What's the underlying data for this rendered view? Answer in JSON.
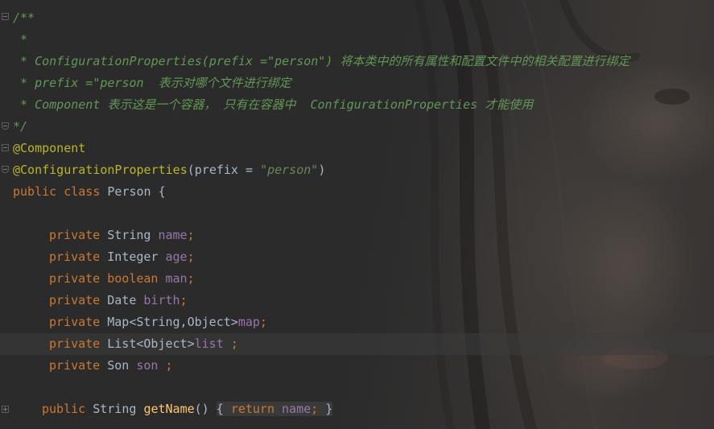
{
  "comment": {
    "open": "/**",
    "star": " *",
    "line1": " * ConfigurationProperties(prefix =\"person\") 将本类中的所有属性和配置文件中的相关配置进行绑定",
    "line2": " * prefix =\"person  表示对哪个文件进行绑定",
    "line3": " * Component 表示这是一个容器， 只有在容器中  ConfigurationProperties 才能使用",
    "close": "*/"
  },
  "annotations": {
    "component": "@Component",
    "config_props": "@ConfigurationProperties",
    "open_paren": "(",
    "prefix_param": "prefix",
    "equals": " = ",
    "prefix_value": "\"person\"",
    "close_paren": ")"
  },
  "class_decl": {
    "public": "public",
    "class": "class",
    "name": "Person",
    "brace": "{"
  },
  "fields": [
    {
      "modifier": "private",
      "type": "String",
      "name": "name",
      "suffix": ";"
    },
    {
      "modifier": "private",
      "type": "Integer",
      "name": "age",
      "suffix": ";"
    },
    {
      "modifier": "private",
      "type": "boolean",
      "name": "man",
      "suffix": ";"
    },
    {
      "modifier": "private",
      "type": "Date",
      "name": "birth",
      "suffix": ";"
    },
    {
      "modifier": "private",
      "type": "Map<String,Object>",
      "name": "map",
      "suffix": ";"
    },
    {
      "modifier": "private",
      "type": "List<Object>",
      "name": "list",
      "suffix": " ;"
    },
    {
      "modifier": "private",
      "type": "Son",
      "name": "son",
      "suffix": " ;"
    }
  ],
  "method": {
    "public": "public",
    "return_type": "String",
    "name": "getName",
    "parens": "()",
    "body_open": "{",
    "return_kw": "return",
    "field": "name",
    "semi": ";",
    "body_close": "}"
  },
  "colors": {
    "background": "#2b2b2b",
    "comment": "#629755",
    "annotation": "#bbb529",
    "keyword": "#cc7832",
    "string": "#6a8759",
    "field": "#9876aa",
    "method": "#ffc66d",
    "text": "#a9b7c6"
  }
}
